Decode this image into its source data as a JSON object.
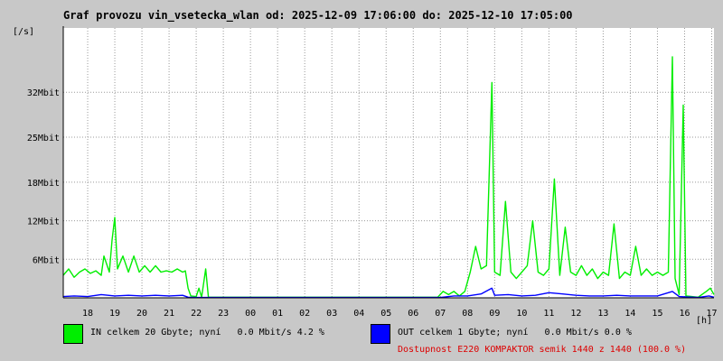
{
  "title": "Graf provozu vin_vsetecka_wlan od: 2025-12-09 17:06:00 do: 2025-12-10 17:05:00",
  "y_unit": "[/s]",
  "x_unit": "[h]",
  "legend": {
    "in": {
      "label": "IN celkem 20 Gbyte; nyní   0.0 Mbit/s 4.2 %",
      "color": "#00ee00"
    },
    "out": {
      "label": "OUT celkem 1 Gbyte; nyní   0.0 Mbit/s 0.0 %",
      "color": "#0000ff"
    }
  },
  "availability": {
    "text": "Dostupnost E220 KOMPAKTOR semik 1440 z 1440 (100.0 %)",
    "color": "#dd0000"
  },
  "chart_data": {
    "type": "area",
    "title": "Graf provozu vin_vsetecka_wlan od: 2025-12-09 17:06:00 do: 2025-12-10 17:05:00",
    "ylabel": "[/s]",
    "xlabel": "[h]",
    "y_unit": "Mbit",
    "ylim": [
      0,
      42
    ],
    "xlim": [
      17.1,
      17.1833
    ],
    "grid": true,
    "y_ticks": [
      {
        "value": 6,
        "label": "6Mbit"
      },
      {
        "value": 12,
        "label": "12Mbit"
      },
      {
        "value": 18,
        "label": "18Mbit"
      },
      {
        "value": 25,
        "label": "25Mbit"
      },
      {
        "value": 32,
        "label": "32Mbit"
      }
    ],
    "x_ticks": [
      {
        "t": 18,
        "label": "18"
      },
      {
        "t": 19,
        "label": "19"
      },
      {
        "t": 20,
        "label": "20"
      },
      {
        "t": 21,
        "label": "21"
      },
      {
        "t": 22,
        "label": "22"
      },
      {
        "t": 23,
        "label": "23"
      },
      {
        "t": 24,
        "label": "00"
      },
      {
        "t": 25,
        "label": "01"
      },
      {
        "t": 26,
        "label": "02"
      },
      {
        "t": 27,
        "label": "03"
      },
      {
        "t": 28,
        "label": "04"
      },
      {
        "t": 29,
        "label": "05"
      },
      {
        "t": 30,
        "label": "06"
      },
      {
        "t": 31,
        "label": "07"
      },
      {
        "t": 32,
        "label": "08"
      },
      {
        "t": 33,
        "label": "09"
      },
      {
        "t": 34,
        "label": "10"
      },
      {
        "t": 35,
        "label": "11"
      },
      {
        "t": 36,
        "label": "12"
      },
      {
        "t": 37,
        "label": "13"
      },
      {
        "t": 38,
        "label": "14"
      },
      {
        "t": 39,
        "label": "15"
      },
      {
        "t": 40,
        "label": "16"
      },
      {
        "t": 41,
        "label": "17"
      }
    ],
    "x_range_hours": [
      17.1,
      41.0833
    ],
    "series": [
      {
        "name": "IN",
        "color": "#00ee00",
        "points": [
          [
            17.1,
            3.5
          ],
          [
            17.3,
            4.5
          ],
          [
            17.5,
            3.2
          ],
          [
            17.7,
            4.0
          ],
          [
            17.9,
            4.5
          ],
          [
            18.1,
            3.8
          ],
          [
            18.3,
            4.2
          ],
          [
            18.5,
            3.5
          ],
          [
            18.6,
            6.5
          ],
          [
            18.8,
            4.0
          ],
          [
            18.9,
            9.0
          ],
          [
            19.0,
            12.5
          ],
          [
            19.1,
            4.5
          ],
          [
            19.3,
            6.5
          ],
          [
            19.5,
            4.0
          ],
          [
            19.7,
            6.5
          ],
          [
            19.9,
            4.0
          ],
          [
            20.1,
            5.0
          ],
          [
            20.3,
            4.0
          ],
          [
            20.5,
            5.0
          ],
          [
            20.7,
            4.0
          ],
          [
            20.9,
            4.2
          ],
          [
            21.1,
            4.0
          ],
          [
            21.3,
            4.5
          ],
          [
            21.5,
            4.0
          ],
          [
            21.6,
            4.2
          ],
          [
            21.7,
            1.5
          ],
          [
            21.8,
            0.3
          ],
          [
            22.0,
            0.2
          ],
          [
            22.1,
            1.5
          ],
          [
            22.2,
            0.1
          ],
          [
            22.35,
            4.5
          ],
          [
            22.45,
            0.1
          ],
          [
            23.0,
            0.1
          ],
          [
            30.9,
            0.1
          ],
          [
            31.1,
            1.0
          ],
          [
            31.3,
            0.5
          ],
          [
            31.5,
            1.0
          ],
          [
            31.7,
            0.3
          ],
          [
            31.9,
            1.0
          ],
          [
            32.1,
            4.0
          ],
          [
            32.3,
            8.0
          ],
          [
            32.5,
            4.5
          ],
          [
            32.7,
            5.0
          ],
          [
            32.9,
            33.5
          ],
          [
            33.0,
            4.0
          ],
          [
            33.2,
            3.5
          ],
          [
            33.4,
            15.0
          ],
          [
            33.6,
            4.0
          ],
          [
            33.8,
            3.0
          ],
          [
            34.0,
            4.0
          ],
          [
            34.2,
            5.0
          ],
          [
            34.4,
            12.0
          ],
          [
            34.6,
            4.0
          ],
          [
            34.8,
            3.5
          ],
          [
            35.0,
            4.5
          ],
          [
            35.2,
            18.5
          ],
          [
            35.4,
            3.5
          ],
          [
            35.6,
            11.0
          ],
          [
            35.8,
            4.0
          ],
          [
            36.0,
            3.5
          ],
          [
            36.2,
            5.0
          ],
          [
            36.4,
            3.5
          ],
          [
            36.6,
            4.5
          ],
          [
            36.8,
            3.0
          ],
          [
            37.0,
            4.0
          ],
          [
            37.2,
            3.5
          ],
          [
            37.4,
            11.5
          ],
          [
            37.6,
            3.0
          ],
          [
            37.8,
            4.0
          ],
          [
            38.0,
            3.5
          ],
          [
            38.2,
            8.0
          ],
          [
            38.4,
            3.5
          ],
          [
            38.6,
            4.5
          ],
          [
            38.8,
            3.5
          ],
          [
            39.0,
            4.0
          ],
          [
            39.2,
            3.5
          ],
          [
            39.4,
            4.0
          ],
          [
            39.55,
            37.5
          ],
          [
            39.65,
            3.0
          ],
          [
            39.8,
            0.5
          ],
          [
            39.95,
            30.0
          ],
          [
            40.05,
            0.3
          ],
          [
            40.5,
            0.1
          ],
          [
            40.8,
            1.0
          ],
          [
            40.95,
            1.5
          ],
          [
            41.0833,
            0.5
          ]
        ]
      },
      {
        "name": "OUT",
        "color": "#0000ff",
        "points": [
          [
            17.1,
            0.2
          ],
          [
            17.5,
            0.3
          ],
          [
            18.0,
            0.2
          ],
          [
            18.5,
            0.5
          ],
          [
            19.0,
            0.3
          ],
          [
            19.5,
            0.4
          ],
          [
            20.0,
            0.3
          ],
          [
            20.5,
            0.4
          ],
          [
            21.0,
            0.3
          ],
          [
            21.5,
            0.4
          ],
          [
            21.7,
            0.1
          ],
          [
            22.0,
            0.05
          ],
          [
            31.0,
            0.05
          ],
          [
            31.5,
            0.3
          ],
          [
            32.0,
            0.3
          ],
          [
            32.5,
            0.6
          ],
          [
            32.9,
            1.5
          ],
          [
            33.0,
            0.4
          ],
          [
            33.5,
            0.5
          ],
          [
            34.0,
            0.3
          ],
          [
            34.5,
            0.4
          ],
          [
            35.0,
            0.8
          ],
          [
            35.5,
            0.6
          ],
          [
            36.0,
            0.4
          ],
          [
            36.5,
            0.3
          ],
          [
            37.0,
            0.3
          ],
          [
            37.5,
            0.4
          ],
          [
            38.0,
            0.3
          ],
          [
            38.5,
            0.3
          ],
          [
            39.0,
            0.3
          ],
          [
            39.55,
            1.0
          ],
          [
            39.8,
            0.2
          ],
          [
            40.5,
            0.05
          ],
          [
            40.9,
            0.3
          ],
          [
            41.0833,
            0.1
          ]
        ]
      }
    ]
  }
}
